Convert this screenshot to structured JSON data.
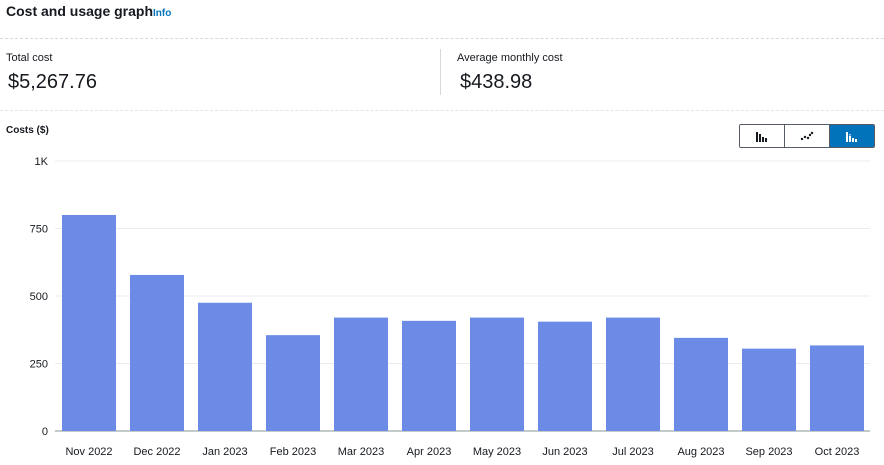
{
  "header": {
    "title": "Cost and usage graph",
    "info_label": "Info"
  },
  "summary": {
    "total_label": "Total cost",
    "total_value": "$5,267.76",
    "average_label": "Average monthly cost",
    "average_value": "$438.98"
  },
  "chart_view": {
    "options": [
      "bar-chart-icon",
      "scatter-chart-icon",
      "stacked-bar-chart-icon"
    ],
    "selected": "stacked-bar-chart-icon"
  },
  "colors": {
    "bar": "#6b8be6",
    "accent": "#0073bb"
  },
  "chart_data": {
    "type": "bar",
    "ylabel": "Costs ($)",
    "categories": [
      "Nov 2022",
      "Dec 2022",
      "Jan 2023",
      "Feb 2023",
      "Mar 2023",
      "Apr 2023",
      "May 2023",
      "Jun 2023",
      "Jul 2023",
      "Aug 2023",
      "Sep 2023",
      "Oct 2023"
    ],
    "values": [
      800,
      578,
      475,
      355,
      420,
      408,
      420,
      405,
      420,
      345,
      305,
      317
    ],
    "ylim": [
      0,
      1000
    ],
    "yticks": [
      0,
      250,
      500,
      750,
      1000
    ],
    "ytick_labels": [
      "0",
      "250",
      "500",
      "750",
      "1K"
    ],
    "grid": true
  }
}
